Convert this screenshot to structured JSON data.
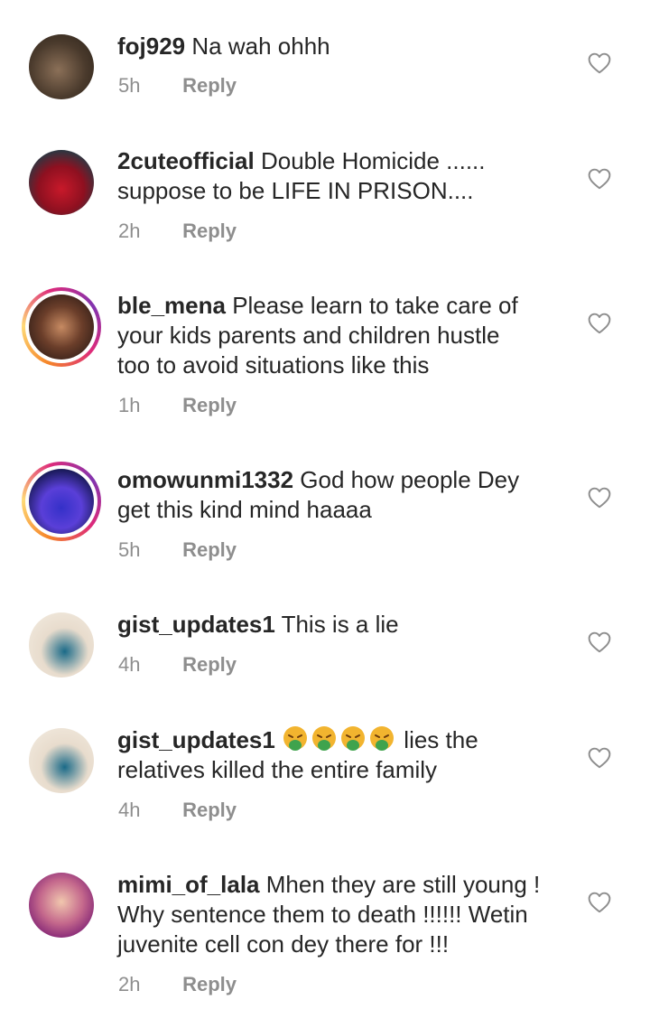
{
  "comments": [
    {
      "username": "foj929",
      "text": "Na wah ohhh",
      "time": "5h",
      "reply_label": "Reply",
      "avatar": "user-photo-avatar"
    },
    {
      "username": "2cuteofficial",
      "text": "Double Homicide ......",
      "text_line2": "suppose to be LIFE IN PRISON....",
      "time": "2h",
      "reply_label": "Reply",
      "avatar": "user-photo-avatar"
    },
    {
      "username": "ble_mena",
      "text": "Please learn to take care of",
      "text_line2": "your kids parents and children hustle",
      "text_line3": "too to avoid situations like this",
      "time": "1h",
      "reply_label": "Reply",
      "avatar": "user-photo-avatar-story-ring"
    },
    {
      "username": "omowunmi1332",
      "text": "God how people Dey",
      "text_line2": "get this kind mind haaaa",
      "time": "5h",
      "reply_label": "Reply",
      "avatar": "user-photo-avatar-story-ring"
    },
    {
      "username": "gist_updates1",
      "text": "This is a lie",
      "time": "4h",
      "reply_label": "Reply",
      "avatar": "user-photo-avatar"
    },
    {
      "username": "gist_updates1",
      "text": "lies the",
      "text_line2": "relatives killed the entire family",
      "emoji": "🤮🤮🤮🤮",
      "time": "4h",
      "reply_label": "Reply",
      "avatar": "user-photo-avatar"
    },
    {
      "username": "mimi_of_lala",
      "text": "Mhen they are still young !",
      "text_line2": "Why sentence them to death !!!!!! Wetin",
      "text_line3": "juvenite cell con dey there for !!!",
      "time": "2h",
      "reply_label": "Reply",
      "avatar": "user-photo-avatar"
    }
  ],
  "icons": {
    "like": "heart-outline-icon",
    "emoji": "face-vomiting-emoji"
  },
  "colors": {
    "text": "#262626",
    "meta": "#8e8e8e",
    "story_ring_start": "#f58529",
    "story_ring_end": "#dd2a7b"
  }
}
